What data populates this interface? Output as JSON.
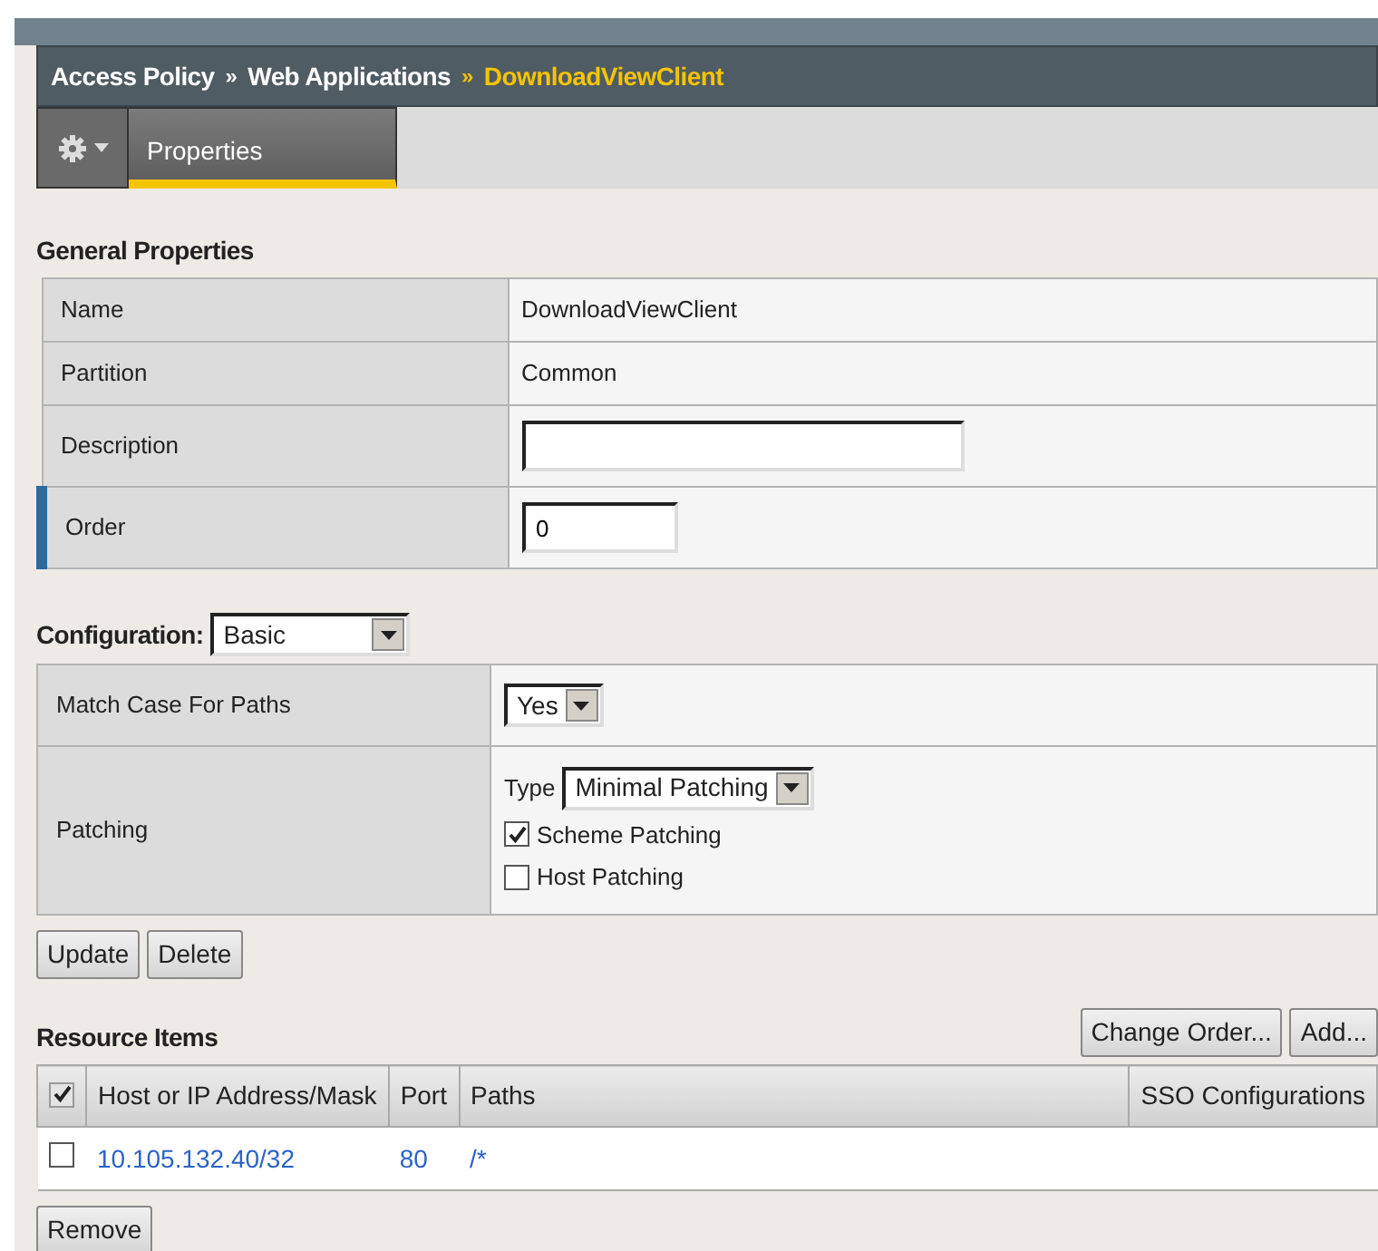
{
  "breadcrumb": [
    {
      "label": "Access Policy",
      "current": false
    },
    {
      "label": "Web Applications",
      "current": false
    },
    {
      "label": "DownloadViewClient",
      "current": true
    }
  ],
  "breadcrumb_separator": "»",
  "tabs": [
    {
      "label": "Properties",
      "selected": true
    }
  ],
  "general_properties": {
    "title": "General Properties",
    "rows": [
      {
        "kind": "text",
        "label": "Name",
        "value": "DownloadViewClient",
        "required": false
      },
      {
        "kind": "text",
        "label": "Partition",
        "value": "Common",
        "required": false
      },
      {
        "kind": "input",
        "label": "Description",
        "value": "",
        "required": false
      },
      {
        "kind": "input",
        "label": "Order",
        "value": "0",
        "required": true
      }
    ]
  },
  "configuration": {
    "label": "Configuration:",
    "value": "Basic"
  },
  "settings": [
    {
      "kind": "select",
      "label": "Match Case For Paths",
      "value": "Yes"
    },
    {
      "kind": "patching",
      "label": "Patching",
      "type_label": "Type",
      "type_value": "Minimal Patching",
      "options": [
        {
          "label": "Scheme Patching",
          "checked": true
        },
        {
          "label": "Host Patching",
          "checked": false
        }
      ]
    }
  ],
  "form_buttons": [
    "Update",
    "Delete"
  ],
  "resource_items": {
    "title": "Resource Items",
    "buttons": [
      "Change Order...",
      "Add..."
    ],
    "select_all_checked": true,
    "columns": [
      "Host or IP Address/Mask",
      "Port",
      "Paths",
      "SSO Configurations"
    ],
    "rows": [
      {
        "checked": false,
        "cells": [
          "10.105.132.40/32",
          "80",
          "/*",
          ""
        ]
      }
    ],
    "footer_buttons": [
      "Remove"
    ]
  }
}
